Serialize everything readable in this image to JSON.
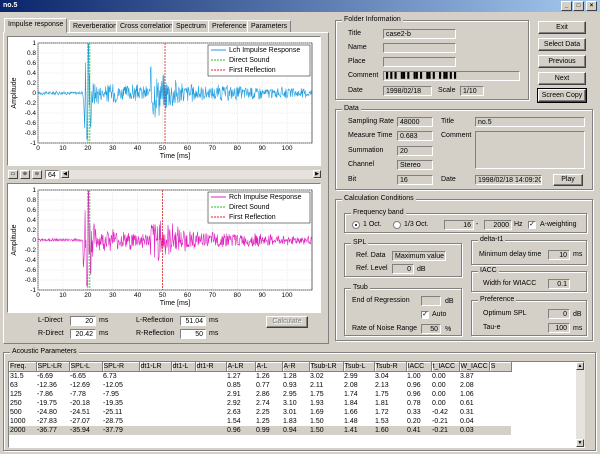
{
  "window": {
    "title": "no.5",
    "minimize": "_",
    "maximize": "□",
    "close": "×"
  },
  "tabs": [
    "Impulse response",
    "Reverberation",
    "Cross correlation",
    "Spectrum",
    "Preference",
    "Parameters"
  ],
  "plot_top": {
    "ylabel": "Amplitude",
    "xlabel": "Time [ms]",
    "yticks": [
      "1",
      "0.8",
      "0.6",
      "0.4",
      "0.2",
      "0",
      "-0.2",
      "-0.4",
      "-0.6",
      "-0.8",
      "-1"
    ],
    "xticks": [
      "0",
      "10",
      "20",
      "30",
      "40",
      "50",
      "60",
      "70",
      "80",
      "90",
      "100"
    ],
    "legend": [
      "Lch Impulse Response",
      "Direct Sound",
      "First Reflection"
    ],
    "color": "#1e9ee0",
    "direct_color": "#20c020",
    "reflection_color": "#e02020"
  },
  "plot_bottom": {
    "ylabel": "Amplitude",
    "xlabel": "Time [ms]",
    "yticks": [
      "1",
      "0.8",
      "0.6",
      "0.4",
      "0.2",
      "0",
      "-0.2",
      "-0.4",
      "-0.6",
      "-0.8",
      "-1"
    ],
    "xticks": [
      "0",
      "10",
      "20",
      "30",
      "40",
      "50",
      "60",
      "70",
      "80",
      "90",
      "100"
    ],
    "legend": [
      "Rch Impulse Response",
      "Direct Sound",
      "First Reflection"
    ],
    "color": "#e020c0"
  },
  "chart_data": [
    {
      "type": "line",
      "title": "",
      "xlabel": "Time [ms]",
      "ylabel": "Amplitude",
      "xlim": [
        0,
        110
      ],
      "ylim": [
        -1,
        1
      ],
      "series": [
        {
          "name": "Lch Impulse Response"
        },
        {
          "name": "Direct Sound",
          "x": 20
        },
        {
          "name": "First Reflection",
          "x": 51
        }
      ]
    },
    {
      "type": "line",
      "title": "",
      "xlabel": "Time [ms]",
      "ylabel": "Amplitude",
      "xlim": [
        0,
        110
      ],
      "ylim": [
        -1,
        1
      ],
      "series": [
        {
          "name": "Rch Impulse Response"
        },
        {
          "name": "Direct Sound",
          "x": 20
        },
        {
          "name": "First Reflection",
          "x": 50
        }
      ]
    }
  ],
  "toolbar": {
    "zoom_value": "64"
  },
  "direct": {
    "l_label": "L-Direct",
    "l_value": "20",
    "r_label": "R-Direct",
    "r_value": "20.42",
    "unit": "ms"
  },
  "reflection": {
    "l_label": "L-Reflection",
    "l_value": "51.04",
    "r_label": "R-Reflection",
    "r_value": "50",
    "unit": "ms"
  },
  "calculate_label": "Calculate",
  "folder": {
    "group": "Folder Information",
    "title_label": "Title",
    "title_value": "case2-b",
    "name_label": "Name",
    "place_label": "Place",
    "comment_label": "Comment",
    "comment_value": "▌▌▌▐▌▌▐▌▌▐▌▌▐▐▌▌▌",
    "date_label": "Date",
    "date_value": "1998/02/18",
    "scale_label": "Scale",
    "scale_value": "1/10"
  },
  "buttons": {
    "exit": "Exit",
    "select_data": "Select Data",
    "previous": "Previous",
    "next": "Next",
    "screen_copy": "Screen Copy"
  },
  "data": {
    "group": "Data",
    "sampling_label": "Sampling Rate",
    "sampling_value": "48000",
    "title_label": "Title",
    "title_value": "no.5",
    "measure_label": "Measure Time",
    "measure_value": "0.683",
    "comment_label": "Comment",
    "summation_label": "Summation",
    "summation_value": "20",
    "channel_label": "Channel",
    "channel_value": "Stereo",
    "bit_label": "Bit",
    "bit_value": "16",
    "date_label": "Date",
    "date_value": "1998/02/18 14:09:20",
    "play": "Play"
  },
  "calc": {
    "group": "Calculation Conditions",
    "freq_group": "Frequency band",
    "oct1": "1 Oct.",
    "oct3": "1/3 Oct.",
    "freq_from": "16",
    "freq_to": "2000",
    "hz": "Hz",
    "aweight": "A-weighting",
    "spl_group": "SPL",
    "ref_data_label": "Ref. Data",
    "ref_data_value": "Maximum value",
    "ref_level_label": "Ref. Level",
    "ref_level_value": "0",
    "db": "dB",
    "deltat_group": "delta-t1",
    "min_delay_label": "Minimum delay time",
    "min_delay_value": "10",
    "ms": "ms",
    "iacc_group": "IACC",
    "wiacc_label": "Width for WIACC",
    "wiacc_value": "0.1",
    "tsub_group": "Tsub",
    "end_reg_label": "End of Regression",
    "end_reg_unit": "dB",
    "auto_label": "Auto",
    "noise_label": "Rate of Noise Range",
    "noise_value": "50",
    "pct": "%",
    "pref_group": "Preference",
    "opt_spl_label": "Optimum SPL",
    "opt_spl_value": "0",
    "opt_spl_unit": "dB",
    "taue_label": "Tau-e",
    "taue_value": "100",
    "taue_unit": "ms"
  },
  "acoustic": {
    "group": "Acoustic Parameters",
    "headers": [
      "Freq.",
      "SPL-LR",
      "SPL-L",
      "SPL-R",
      "dt1-LR",
      "dt1-L",
      "dt1-R",
      "A-LR",
      "A-L",
      "A-R",
      "Tsub-LR",
      "Tsub-L",
      "Tsub-R",
      "IACC",
      "t_IACC",
      "W_IACC",
      "S"
    ],
    "rows": [
      [
        "31.5",
        "-6.69",
        "-6.65",
        "6.73",
        "",
        "",
        "",
        "1.27",
        "1.26",
        "1.28",
        "3.02",
        "2.99",
        "3.04",
        "1.00",
        "0.00",
        "3.87",
        ""
      ],
      [
        "63",
        "-12.36",
        "-12.69",
        "-12.05",
        "",
        "",
        "",
        "0.85",
        "0.77",
        "0.93",
        "2.11",
        "2.08",
        "2.13",
        "0.96",
        "0.00",
        "2.08",
        ""
      ],
      [
        "125",
        "-7.86",
        "-7.78",
        "-7.95",
        "",
        "",
        "",
        "2.91",
        "2.86",
        "2.95",
        "1.75",
        "1.74",
        "1.75",
        "0.96",
        "0.00",
        "1.06",
        ""
      ],
      [
        "250",
        "-19.75",
        "-20.18",
        "-19.35",
        "",
        "",
        "",
        "2.92",
        "2.74",
        "3.10",
        "1.93",
        "1.84",
        "1.81",
        "0.78",
        "0.00",
        "0.61",
        ""
      ],
      [
        "500",
        "-24.80",
        "-24.51",
        "-25.11",
        "",
        "",
        "",
        "2.63",
        "2.25",
        "3.01",
        "1.69",
        "1.66",
        "1.72",
        "0.33",
        "-0.42",
        "0.31",
        ""
      ],
      [
        "1000",
        "-27.83",
        "-27.07",
        "-28.75",
        "",
        "",
        "",
        "1.54",
        "1.25",
        "1.83",
        "1.50",
        "1.48",
        "1.53",
        "0.20",
        "-0.21",
        "0.04",
        ""
      ],
      [
        "2000",
        "-36.77",
        "-35.94",
        "-37.79",
        "",
        "",
        "",
        "0.96",
        "0.99",
        "0.94",
        "1.50",
        "1.41",
        "1.60",
        "0.41",
        "-0.21",
        "0.03",
        ""
      ]
    ]
  }
}
